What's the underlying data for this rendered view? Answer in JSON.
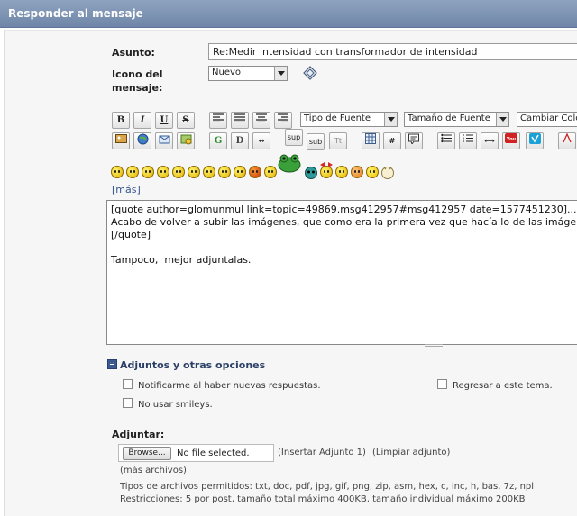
{
  "window": {
    "title": "Responder al mensaje"
  },
  "form": {
    "subject_label": "Asunto:",
    "subject_value": "Re:Medir intensidad con transformador de intensidad",
    "icon_label_line1": "Icono del",
    "icon_label_line2": "mensaje:",
    "icon_selected": "Nuevo"
  },
  "toolbar": {
    "font_face": "Tipo de Fuente",
    "font_size": "Tamaño de Fuente",
    "font_color": "Cambiar Color",
    "sup": "sup",
    "sub": "sub",
    "tt": "Tt"
  },
  "smileys": {
    "more_link": "[más]"
  },
  "message": {
    "body": "[quote author=glomunmul link=topic=49869.msg412957#msg412957 date=1577451230]...\nAcabo de volver a subir las imágenes, que como era la primera vez que hacía lo de las imágenes\n[/quote]\n\nTampoco,  mejor adjuntalas."
  },
  "attachments": {
    "section_title": "Adjuntos y otras opciones",
    "notify_label": "Notificarme al haber nuevas respuestas.",
    "return_label": "Regresar a este tema.",
    "no_smileys_label": "No usar smileys.",
    "attach_label": "Adjuntar:",
    "browse_label": "Browse...",
    "no_file": "No file selected.",
    "insert_link": "(Insertar Adjunto 1)",
    "clear_link": "(Limpiar adjunto)",
    "more_files": "(más archivos)",
    "allowed_types": "Tipos de archivos permitidos: txt, doc, pdf, jpg, gif, png, zip, asm, hex, c, inc, h, bas, 7z, npl",
    "restrictions": "Restricciones: 5 por post, tamaño total máximo 400KB, tamaño individual máximo 200KB"
  },
  "colors": {
    "header": "#7a90b0",
    "link": "#34538c",
    "section": "#2b3f66"
  }
}
